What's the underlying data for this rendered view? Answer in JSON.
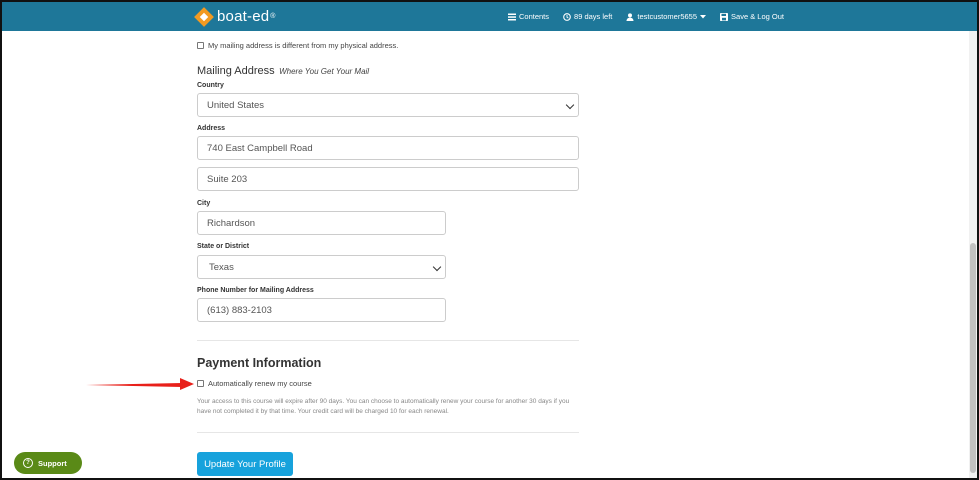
{
  "navbar": {
    "logo_text": "boat-ed",
    "logo_reg": "®",
    "contents_label": "Contents",
    "days_left_label": "89 days left",
    "user_label": "testcustomer5655",
    "save_logout_label": "Save & Log Out",
    "brand_color": "#1e7799",
    "logo_color": "#f29a22"
  },
  "mailing_diff": {
    "label": "My mailing address is different from my physical address."
  },
  "mailing_address": {
    "title": "Mailing Address",
    "subtitle": "Where You Get Your Mail"
  },
  "country": {
    "label": "Country",
    "value": "United States"
  },
  "address": {
    "label": "Address",
    "line1": "740 East Campbell Road",
    "line2": "Suite 203"
  },
  "city": {
    "label": "City",
    "value": "Richardson"
  },
  "state": {
    "label": "State or District",
    "value": "Texas"
  },
  "phone": {
    "label": "Phone Number for Mailing Address",
    "value": "(613) 883-2103"
  },
  "payment": {
    "title": "Payment Information",
    "auto_renew_label": "Automatically renew my course",
    "help_text": "Your access to this course will expire after 90 days. You can choose to automatically renew your course for another 30 days if you have not completed it by that time. Your credit card will be charged 10 for each renewal."
  },
  "update_button": {
    "label": "Update Your Profile",
    "color": "#17a2dc"
  },
  "support": {
    "label": "Support",
    "color": "#5a8a17"
  },
  "annotation": {
    "arrow_color": "#e8201a"
  }
}
